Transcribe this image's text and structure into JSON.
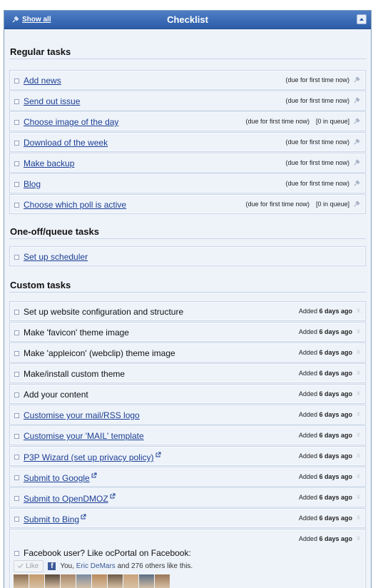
{
  "panel": {
    "show_all": "Show all",
    "title": "Checklist"
  },
  "sections": {
    "regular": "Regular tasks",
    "oneoff": "One-off/queue tasks",
    "custom": "Custom tasks"
  },
  "regular_tasks": [
    {
      "label": "Add news",
      "due": "(due for first time now)",
      "queue": ""
    },
    {
      "label": "Send out issue",
      "due": "(due for first time now)",
      "queue": ""
    },
    {
      "label": "Choose image of the day",
      "due": "(due for first time now)",
      "queue": "[0 in queue]"
    },
    {
      "label": "Download of the week",
      "due": "(due for first time now)",
      "queue": ""
    },
    {
      "label": "Make backup",
      "due": "(due for first time now)",
      "queue": ""
    },
    {
      "label": "Blog",
      "due": "(due for first time now)",
      "queue": ""
    },
    {
      "label": "Choose which poll is active",
      "due": "(due for first time now)",
      "queue": "[0 in queue]"
    }
  ],
  "oneoff_tasks": [
    {
      "label": "Set up scheduler"
    }
  ],
  "custom_tasks": [
    {
      "label": "Set up website configuration and structure",
      "added": "Added",
      "ago": "6 days ago"
    },
    {
      "label": "Make 'favicon' theme image",
      "added": "Added",
      "ago": "6 days ago"
    },
    {
      "label": "Make 'appleicon' (webclip) theme image",
      "added": "Added",
      "ago": "6 days ago"
    },
    {
      "label": "Make/install custom theme",
      "added": "Added",
      "ago": "6 days ago"
    },
    {
      "label": "Add your content",
      "added": "Added",
      "ago": "6 days ago"
    },
    {
      "label": "Customise your mail/RSS logo",
      "added": "Added",
      "ago": "6 days ago"
    },
    {
      "label": "Customise your 'MAIL' template",
      "added": "Added",
      "ago": "6 days ago"
    },
    {
      "label": "P3P Wizard (set up privacy policy)",
      "added": "Added",
      "ago": "6 days ago"
    },
    {
      "label": "Submit to Google",
      "added": "Added",
      "ago": "6 days ago"
    },
    {
      "label": "Submit to OpenDMOZ",
      "added": "Added",
      "ago": "6 days ago"
    },
    {
      "label": "Submit to Bing",
      "added": "Added",
      "ago": "6 days ago"
    }
  ],
  "facebook_task": {
    "added": "Added",
    "ago": "6 days ago",
    "label": "Facebook user? Like ocPortal on Facebook:",
    "like_button": "Like",
    "like_prefix": "You,",
    "like_name": "Eric DeMars",
    "like_suffix": "and 276 others like this."
  },
  "close_glyph": "x",
  "colors": {
    "titlebar": "#3a6ab5",
    "link": "#1c3f94",
    "panel_bg": "#eef3fa",
    "facebook": "#3b5998"
  }
}
